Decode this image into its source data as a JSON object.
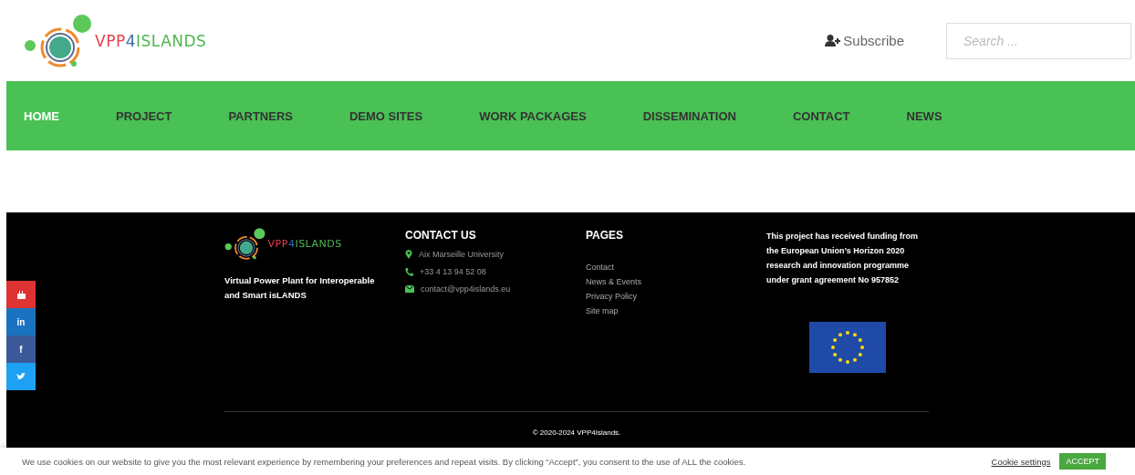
{
  "logo": {
    "parts": [
      {
        "text": "VPP",
        "color": "#e8404a"
      },
      {
        "text": "4",
        "color": "#3b6aa8"
      },
      {
        "text": "ISLANDS",
        "color": "#4cb84f"
      }
    ]
  },
  "header": {
    "subscribe": "Subscribe",
    "search": {
      "placeholder": "Search ..."
    }
  },
  "nav": [
    {
      "label": "HOME",
      "selected": true
    },
    {
      "label": "PROJECT",
      "selected": false
    },
    {
      "label": "PARTNERS",
      "selected": false
    },
    {
      "label": "DEMO SITES",
      "selected": false
    },
    {
      "label": "WORK PACKAGES",
      "selected": false
    },
    {
      "label": "DISSEMINATION",
      "selected": false
    },
    {
      "label": "CONTACT",
      "selected": false
    },
    {
      "label": "NEWS",
      "selected": false
    }
  ],
  "social": [
    {
      "kind": "youtube",
      "color": "#dd3333"
    },
    {
      "kind": "linkedin",
      "label": "in",
      "color": "#1a73c0"
    },
    {
      "kind": "facebook",
      "label": "f",
      "color": "#3b5998"
    },
    {
      "kind": "twitter",
      "color": "#1da1f2"
    }
  ],
  "footer": {
    "about": {
      "logo": {
        "parts": [
          {
            "text": "VPP",
            "color": "#e8404a"
          },
          {
            "text": "4",
            "color": "#3b6aa8"
          },
          {
            "text": "ISLANDS",
            "color": "#4cb84f"
          }
        ]
      },
      "tagline": "Virtual Power Plant for Interoperable and Smart isLANDS"
    },
    "contact": {
      "title": "CONTACT US",
      "items": [
        {
          "kind": "location",
          "text": "Aix Marseille University"
        },
        {
          "kind": "phone",
          "text": "+33 4 13 94 52 08"
        },
        {
          "kind": "email",
          "text": "contact@vpp4islands.eu"
        }
      ]
    },
    "pages": {
      "title": "PAGES",
      "links": [
        "Contact",
        "News & Events",
        "Privacy Policy",
        "Site map"
      ]
    },
    "funding": {
      "text": "This project has received funding from the European Union’s Horizon 2020 research and innovation programme under grant agreement No 957852"
    },
    "copyright": "© 2020-2024 VPP4Islands."
  },
  "cookie": {
    "text": "We use cookies on our website to give you the most relevant experience by remembering your preferences and repeat visits. By clicking “Accept”, you consent to the use of ALL the cookies.",
    "settings": "Cookie settings",
    "accept": "ACCEPT"
  }
}
